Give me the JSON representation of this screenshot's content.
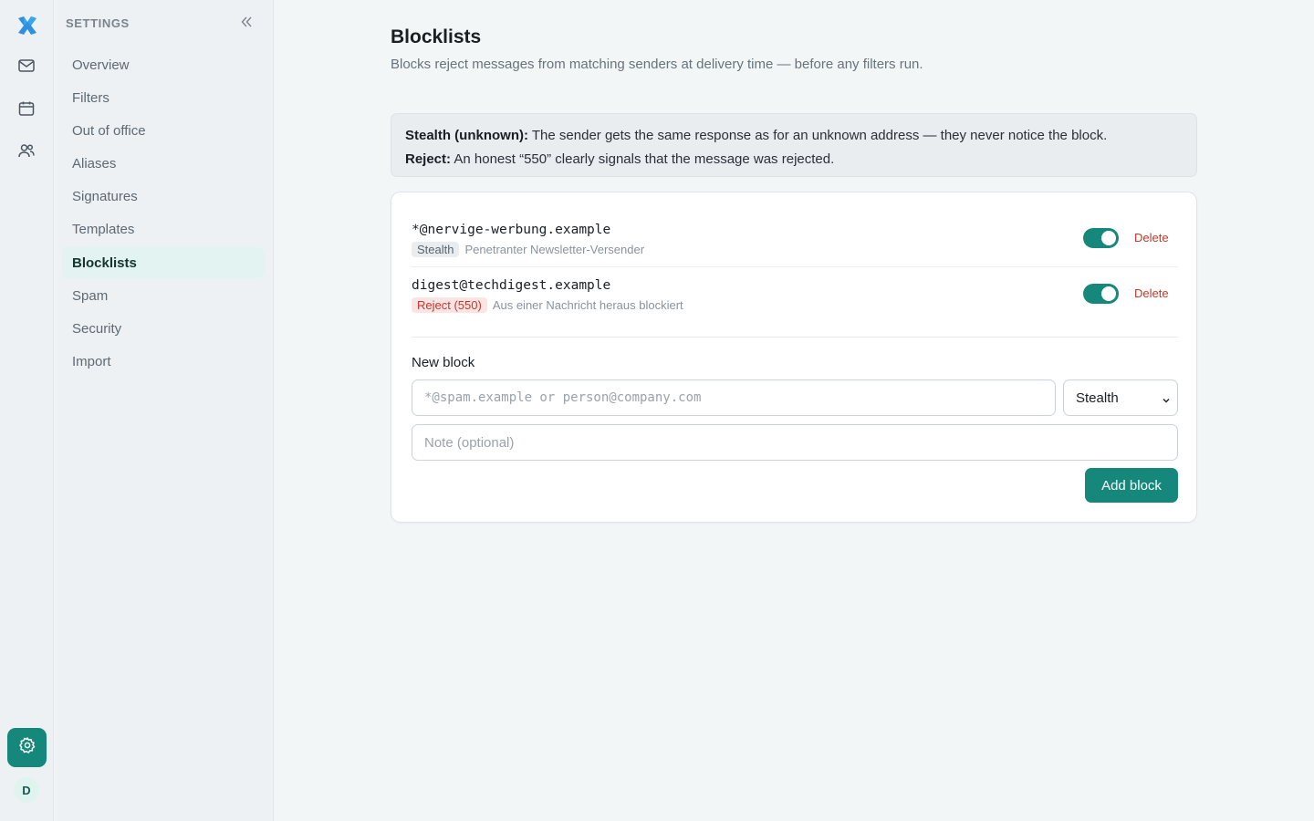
{
  "colors": {
    "accent": "#15877b",
    "danger": "#c0392b",
    "active_nav_bg": "#e2f3f1"
  },
  "rail": {
    "logo_icon": "app-logo-x",
    "items": [
      {
        "icon": "mail-icon"
      },
      {
        "icon": "calendar-icon"
      },
      {
        "icon": "contacts-icon"
      }
    ],
    "settings_icon": "gear-icon",
    "avatar_initial": "D"
  },
  "sidebar": {
    "heading": "SETTINGS",
    "collapse_icon": "double-chevron-left-icon",
    "items": [
      {
        "label": "Overview"
      },
      {
        "label": "Filters"
      },
      {
        "label": "Out of office"
      },
      {
        "label": "Aliases"
      },
      {
        "label": "Signatures"
      },
      {
        "label": "Templates"
      },
      {
        "label": "Blocklists",
        "active": true
      },
      {
        "label": "Spam"
      },
      {
        "label": "Security"
      },
      {
        "label": "Import"
      }
    ]
  },
  "page": {
    "title": "Blocklists",
    "description": "Blocks reject messages from matching senders at delivery time — before any filters run."
  },
  "info": {
    "stealth_label": "Stealth (unknown):",
    "stealth_text": " The sender gets the same response as for an unknown address — they never notice the block.",
    "reject_label": "Reject:",
    "reject_text": " An honest “550” clearly signals that the message was rejected."
  },
  "blocks": [
    {
      "address": "*@nervige-werbung.example",
      "mode": "Stealth",
      "note": "Penetranter Newsletter-Versender",
      "enabled": true,
      "delete_label": "Delete"
    },
    {
      "address": "digest@techdigest.example",
      "mode": "Reject (550)",
      "note": "Aus einer Nachricht heraus blockiert",
      "enabled": true,
      "delete_label": "Delete"
    }
  ],
  "new_block": {
    "label": "New block",
    "address_placeholder": "*@spam.example or person@company.com",
    "address_value": "",
    "mode_selected": "Stealth",
    "note_placeholder": "Note (optional)",
    "note_value": "",
    "submit_label": "Add block"
  }
}
